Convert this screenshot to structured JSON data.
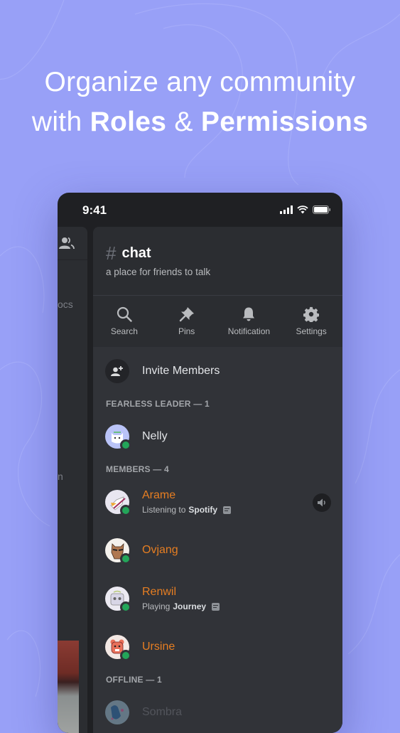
{
  "headline": {
    "line1": "Organize any community",
    "line2_prefix": "with ",
    "line2_bold1": "Roles",
    "line2_mid": " & ",
    "line2_bold2": "Permissions"
  },
  "statusbar": {
    "time": "9:41",
    "icons": [
      "signal-icon",
      "wifi-icon",
      "battery-icon"
    ]
  },
  "left_panel": {
    "partial_texts": [
      "ocs",
      "n"
    ],
    "icon": "members-icon"
  },
  "channel": {
    "hash": "#",
    "name": "chat",
    "topic": "a place for friends to talk"
  },
  "toolbar": [
    {
      "label": "Search",
      "icon": "search-icon"
    },
    {
      "label": "Pins",
      "icon": "pin-icon"
    },
    {
      "label": "Notification",
      "icon": "bell-icon"
    },
    {
      "label": "Settings",
      "icon": "gear-icon"
    }
  ],
  "invite": {
    "label": "Invite Members",
    "icon": "add-user-icon"
  },
  "sections": [
    {
      "title": "FEARLESS LEADER — 1",
      "members": [
        {
          "name": "Nelly",
          "status_prefix": "",
          "status_bold": "",
          "online": true,
          "color": "#e3e5e8",
          "avatar_bg": "#b9c3f7"
        }
      ]
    },
    {
      "title": "MEMBERS — 4",
      "members": [
        {
          "name": "Arame",
          "status_prefix": "Listening to ",
          "status_bold": "Spotify",
          "online": true,
          "color": "#e67e22",
          "avatar_bg": "#e8e6f0",
          "voice": true
        },
        {
          "name": "Ovjang",
          "status_prefix": "",
          "status_bold": "",
          "online": true,
          "color": "#e67e22",
          "avatar_bg": "#f4f1ec"
        },
        {
          "name": "Renwil",
          "status_prefix": "Playing ",
          "status_bold": "Journey",
          "online": true,
          "color": "#e67e22",
          "avatar_bg": "#eceaf2"
        },
        {
          "name": "Ursine",
          "status_prefix": "",
          "status_bold": "",
          "online": true,
          "color": "#e67e22",
          "avatar_bg": "#f3e8e4"
        }
      ]
    },
    {
      "title": "OFFLINE — 1",
      "members": [
        {
          "name": "Sombra",
          "status_prefix": "",
          "status_bold": "",
          "online": false,
          "color": "#6d7078",
          "avatar_bg": "#6f8fa8"
        }
      ]
    }
  ],
  "colors": {
    "background": "#98a0f7",
    "online": "#23a559",
    "role_color": "#e67e22"
  }
}
